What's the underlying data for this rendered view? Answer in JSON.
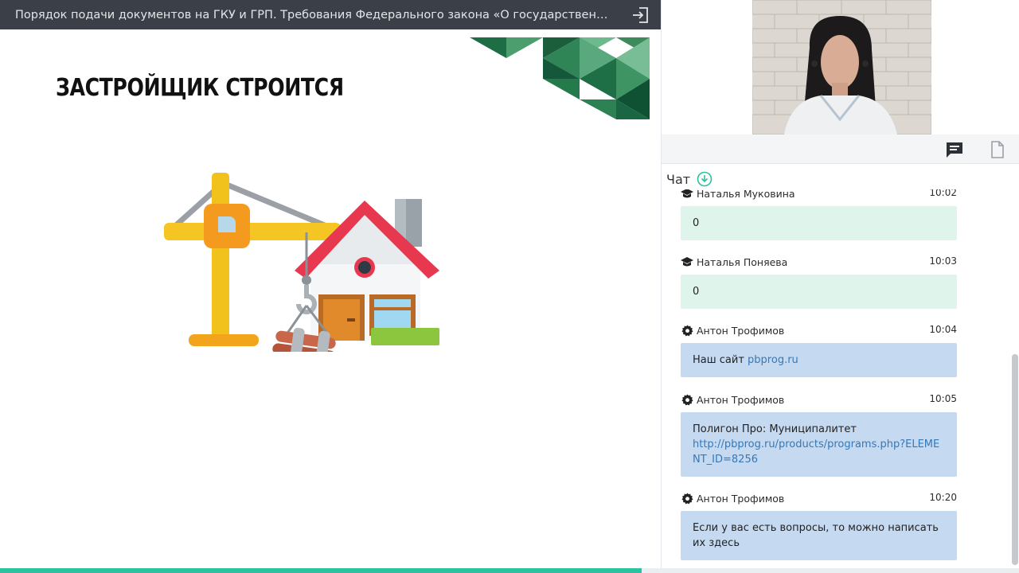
{
  "window": {
    "title": "Порядок подачи документов на ГКУ и ГРП. Требования Федерального закона «О государственной регистрации недвижимости»"
  },
  "slide": {
    "heading": "ЗАСТРОЙЩИК СТРОИТСЯ"
  },
  "progress": {
    "value": 0.63,
    "color": "#2ec1a0"
  },
  "chat": {
    "header": "Чат",
    "messages": [
      {
        "author": "Наталья Муковина",
        "time": "10:02",
        "role": "student",
        "text": "0",
        "link": ""
      },
      {
        "author": "Наталья Поняева",
        "time": "10:03",
        "role": "student",
        "text": "0",
        "link": ""
      },
      {
        "author": "Антон Трофимов",
        "time": "10:04",
        "role": "admin",
        "text": "Наш сайт ",
        "link": "pbprog.ru"
      },
      {
        "author": "Антон Трофимов",
        "time": "10:05",
        "role": "admin",
        "text": "Полигон Про: Муниципалитет",
        "link": "http://pbprog.ru/products/programs.php?ELEMENT_ID=8256"
      },
      {
        "author": "Антон Трофимов",
        "time": "10:20",
        "role": "admin",
        "text": "Если у вас есть вопросы, то можно написать их здесь",
        "link": ""
      }
    ]
  },
  "icons": {
    "exit": "exit-icon",
    "chat_tab": "chat-icon",
    "files_tab": "document-icon",
    "chat_download": "download-circle-icon",
    "student_role": "graduation-cap-icon",
    "admin_role": "gear-icon"
  },
  "colors": {
    "titlebar": "#3b3f48",
    "student_bubble": "#dff5ec",
    "admin_bubble": "#c5daf1",
    "link": "#3478b9",
    "accent": "#2ec1a0"
  }
}
